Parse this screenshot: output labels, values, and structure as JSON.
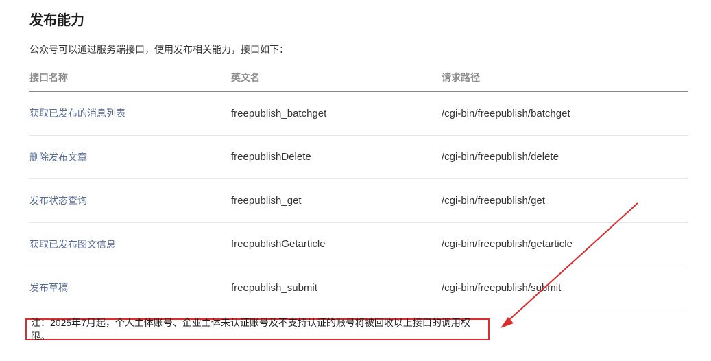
{
  "page": {
    "title": "发布能力",
    "intro": "公众号可以通过服务端接口，使用发布相关能力，接口如下："
  },
  "table": {
    "headers": [
      "接口名称",
      "英文名",
      "请求路径"
    ],
    "rows": [
      {
        "name": "获取已发布的消息列表",
        "en": "freepublish_batchget",
        "path": "/cgi-bin/freepublish/batchget"
      },
      {
        "name": "删除发布文章",
        "en": "freepublishDelete",
        "path": "/cgi-bin/freepublish/delete"
      },
      {
        "name": "发布状态查询",
        "en": "freepublish_get",
        "path": "/cgi-bin/freepublish/get"
      },
      {
        "name": "获取已发布图文信息",
        "en": "freepublishGetarticle",
        "path": "/cgi-bin/freepublish/getarticle"
      },
      {
        "name": "发布草稿",
        "en": "freepublish_submit",
        "path": "/cgi-bin/freepublish/submit"
      }
    ]
  },
  "note": "注：2025年7月起，个人主体账号、企业主体未认证账号及不支持认证的账号将被回收以上接口的调用权限。",
  "colors": {
    "link": "#576b95",
    "annotation": "#e02b2b"
  }
}
